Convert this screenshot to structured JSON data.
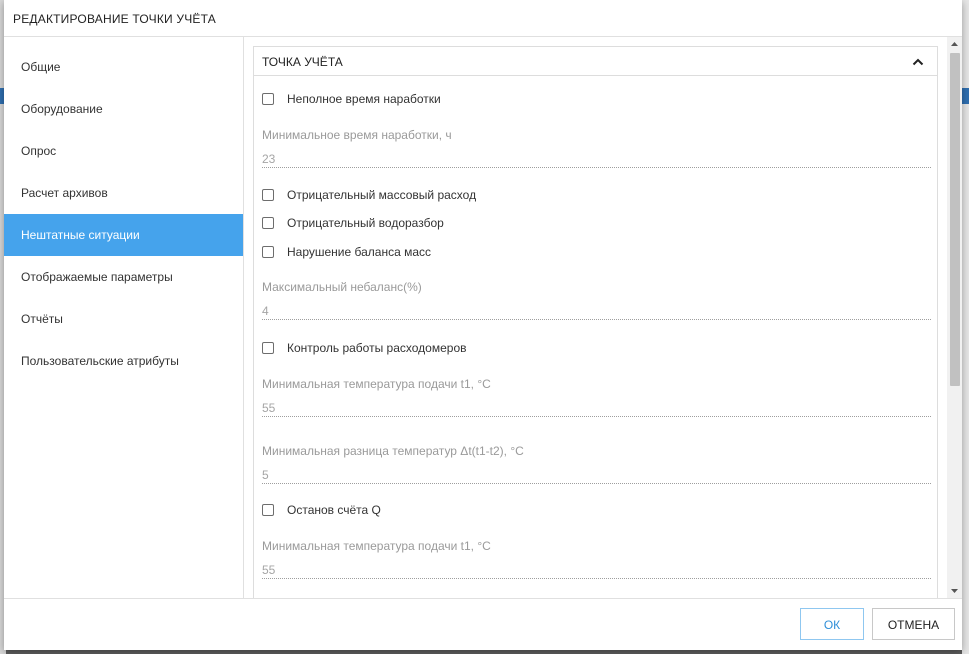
{
  "dialog": {
    "title": "РЕДАКТИРОВАНИЕ ТОЧКИ УЧЁТА",
    "ok_label": "ОК",
    "cancel_label": "ОТМЕНА"
  },
  "nav": {
    "items": [
      {
        "label": "Общие"
      },
      {
        "label": "Оборудование"
      },
      {
        "label": "Опрос"
      },
      {
        "label": "Расчет архивов"
      },
      {
        "label": "Нештатные ситуации",
        "active": true
      },
      {
        "label": "Отображаемые параметры"
      },
      {
        "label": "Отчёты"
      },
      {
        "label": "Пользовательские атрибуты"
      }
    ]
  },
  "section": {
    "title": "ТОЧКА УЧЁТА",
    "collapse_icon": "chevron-up-icon",
    "incomplete_runtime": {
      "label": "Неполное время наработки",
      "checked": false
    },
    "min_runtime": {
      "label": "Минимальное время наработки, ч",
      "value": "23"
    },
    "negative_mass_flow": {
      "label": "Отрицательный массовый расход",
      "checked": false
    },
    "negative_water_draw": {
      "label": "Отрицательный водоразбор",
      "checked": false
    },
    "mass_balance_violation": {
      "label": "Нарушение баланса масс",
      "checked": false
    },
    "max_imbalance": {
      "label": "Максимальный небаланс(%)",
      "value": "4"
    },
    "flowmeter_control": {
      "label": "Контроль работы расходомеров",
      "checked": false
    },
    "min_supply_temp_1": {
      "label": "Минимальная температура подачи t1, °C",
      "value": "55"
    },
    "min_temp_diff": {
      "label": "Минимальная разница температур Δt(t1-t2), °C",
      "value": "5"
    },
    "q_count_stop": {
      "label": "Останов счёта Q",
      "checked": false
    },
    "min_supply_temp_2": {
      "label": "Минимальная температура подачи t1, °C",
      "value": "55"
    }
  },
  "colors": {
    "accent": "#45a3ec",
    "ok_text": "#2f8fd8",
    "field_label": "#9a9a9a"
  }
}
